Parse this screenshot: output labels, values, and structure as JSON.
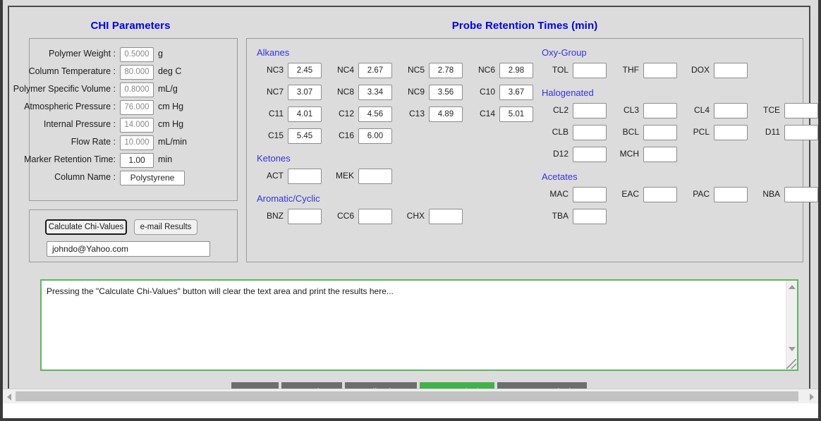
{
  "panels": {
    "chi_parameters_title": "CHI Parameters",
    "probe_title": "Probe Retention Times (min)"
  },
  "parameters": [
    {
      "label": "Polymer Weight :",
      "value": "0.5000",
      "unit": "g",
      "filled": false
    },
    {
      "label": "Column Temperature :",
      "value": "80.000",
      "unit": "deg C",
      "filled": false
    },
    {
      "label": "Polymer Specific Volume :",
      "value": "0.8000",
      "unit": "mL/g",
      "filled": false
    },
    {
      "label": "Atmospheric Pressure :",
      "value": "76.000",
      "unit": "cm Hg",
      "filled": false
    },
    {
      "label": "Internal Pressure :",
      "value": "14.000",
      "unit": "cm Hg",
      "filled": false
    },
    {
      "label": "Flow Rate :",
      "value": "10.000",
      "unit": "mL/min",
      "filled": false
    },
    {
      "label": "Marker Retention Time:",
      "value": "1.00",
      "unit": "min",
      "filled": true
    },
    {
      "label": "Column Name :",
      "value": "Polystyrene",
      "unit": "",
      "filled": true,
      "wide": true
    }
  ],
  "actions": {
    "calculate_label": "Calculate Chi-Values",
    "email_label": "e-mail Results",
    "email_value": "johndo@Yahoo.com"
  },
  "probe_groups": [
    {
      "name": "Alkanes",
      "column": "left",
      "fields": [
        {
          "label": "NC3",
          "value": "2.45"
        },
        {
          "label": "NC4",
          "value": "2.67"
        },
        {
          "label": "NC5",
          "value": "2.78"
        },
        {
          "label": "NC6",
          "value": "2.98"
        },
        {
          "label": "NC7",
          "value": "3.07"
        },
        {
          "label": "NC8",
          "value": "3.34"
        },
        {
          "label": "NC9",
          "value": "3.56"
        },
        {
          "label": "C10",
          "value": "3.67"
        },
        {
          "label": "C11",
          "value": "4.01"
        },
        {
          "label": "C12",
          "value": "4.56"
        },
        {
          "label": "C13",
          "value": "4.89"
        },
        {
          "label": "C14",
          "value": "5.01"
        },
        {
          "label": "C15",
          "value": "5.45"
        },
        {
          "label": "C16",
          "value": "6.00"
        }
      ]
    },
    {
      "name": "Ketones",
      "column": "left",
      "fields": [
        {
          "label": "ACT",
          "value": ""
        },
        {
          "label": "MEK",
          "value": ""
        }
      ]
    },
    {
      "name": "Aromatic/Cyclic",
      "column": "left",
      "fields": [
        {
          "label": "BNZ",
          "value": ""
        },
        {
          "label": "CC6",
          "value": ""
        },
        {
          "label": "CHX",
          "value": ""
        }
      ]
    },
    {
      "name": "Oxy-Group",
      "column": "right",
      "fields": [
        {
          "label": "TOL",
          "value": ""
        },
        {
          "label": "THF",
          "value": ""
        },
        {
          "label": "DOX",
          "value": ""
        }
      ]
    },
    {
      "name": "Halogenated",
      "column": "right",
      "fields": [
        {
          "label": "CL2",
          "value": ""
        },
        {
          "label": "CL3",
          "value": ""
        },
        {
          "label": "CL4",
          "value": ""
        },
        {
          "label": "TCE",
          "value": ""
        },
        {
          "label": "CLB",
          "value": ""
        },
        {
          "label": "BCL",
          "value": ""
        },
        {
          "label": "PCL",
          "value": ""
        },
        {
          "label": "D11",
          "value": ""
        },
        {
          "label": "D12",
          "value": ""
        },
        {
          "label": "MCH",
          "value": ""
        }
      ]
    },
    {
      "name": "Acetates",
      "column": "right",
      "fields": [
        {
          "label": "MAC",
          "value": ""
        },
        {
          "label": "EAC",
          "value": ""
        },
        {
          "label": "PAC",
          "value": ""
        },
        {
          "label": "NBA",
          "value": ""
        },
        {
          "label": "TBA",
          "value": ""
        }
      ]
    }
  ],
  "results": {
    "text": "Pressing the \"Calculate Chi-Values\" button will clear the text area and print the results here..."
  },
  "nav": {
    "items": [
      {
        "label": "Home",
        "active": false
      },
      {
        "label": "Overview",
        "active": false
      },
      {
        "label": "Applications",
        "active": false
      },
      {
        "label": "CHI Analysis",
        "active": true
      },
      {
        "label": "BLEND Analysis",
        "active": false
      }
    ]
  },
  "colors": {
    "heading_blue": "#0000ee",
    "group_blue": "#3333dd",
    "active_green": "#43b149",
    "nav_gray": "#6d6d6d",
    "textarea_border": "#5cb860",
    "page_bg": "#dcdcdc"
  }
}
